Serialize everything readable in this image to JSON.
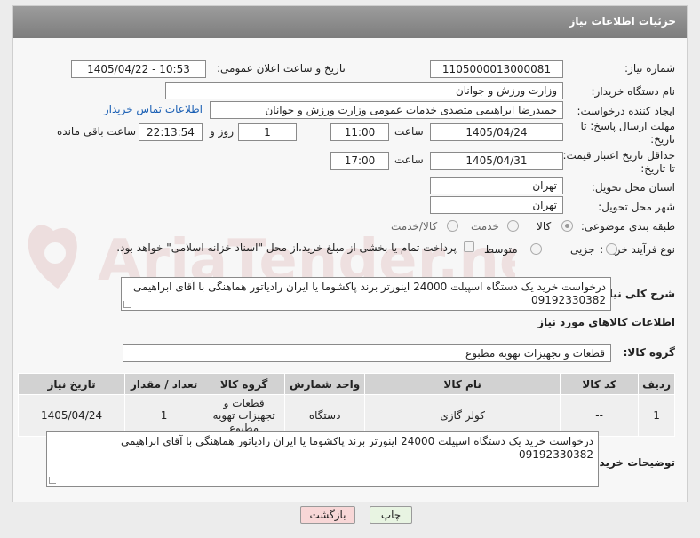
{
  "header": {
    "title": "جزئیات اطلاعات نیاز"
  },
  "fields": {
    "need_number_label": "شماره نیاز:",
    "need_number": "1105000013000081",
    "announce_label": "تاریخ و ساعت اعلان عمومی:",
    "announce_value": "1405/04/22 - 10:53",
    "buyer_org_label": "نام دستگاه خریدار:",
    "buyer_org": "وزارت ورزش و جوانان",
    "creator_label": "ایجاد کننده درخواست:",
    "creator": "حمیدرضا ابراهیمی متصدی خدمات عمومی وزارت ورزش و جوانان",
    "contact_link": "اطلاعات تماس خریدار",
    "deadline_label": "مهلت ارسال پاسخ: تا تاریخ:",
    "deadline_date": "1405/04/24",
    "time_label": "ساعت",
    "deadline_time": "11:00",
    "days_value": "1",
    "days_label": "روز و",
    "remaining_time": "22:13:54",
    "remaining_label": "ساعت باقی مانده",
    "price_valid_label": "حداقل تاریخ اعتبار قیمت: تا تاریخ:",
    "price_valid_date": "1405/04/31",
    "price_valid_time": "17:00",
    "province_label": "استان محل تحویل:",
    "province": "تهران",
    "city_label": "شهر محل تحویل:",
    "city": "تهران",
    "category_label": "طبقه بندی موضوعی:",
    "category_options": [
      "کالا",
      "خدمت",
      "کالا/خدمت"
    ],
    "process_label": "نوع فرآیند خرید :",
    "process_options": [
      "جزیی",
      "متوسط"
    ],
    "payment_note": "پرداخت تمام یا بخشی از مبلغ خرید،از محل \"اسناد خزانه اسلامی\" خواهد بود.",
    "description_label": "شرح کلی نیاز:",
    "description": "درخواست خرید یک دستگاه اسپیلت 24000 اینورتر برند پاکشوما یا ایران رادیاتور هماهنگی با آقای ابراهیمی 09192330382",
    "goods_info_label": "اطلاعات کالاهای مورد نیاز",
    "goods_group_label": "گروه کالا:",
    "goods_group": "قطعات و تجهیزات تهویه مطبوع",
    "buyer_notes_label": "توضیحات خریدار:",
    "buyer_notes": "درخواست خرید یک دستگاه اسپیلت 24000 اینورتر برند پاکشوما یا ایران رادیاتور هماهنگی با آقای ابراهیمی 09192330382"
  },
  "table": {
    "headers": [
      "ردیف",
      "کد کالا",
      "نام کالا",
      "واحد شمارش",
      "گروه کالا",
      "تعداد / مقدار",
      "تاریخ نیاز"
    ],
    "rows": [
      [
        "1",
        "--",
        "کولر گازی",
        "دستگاه",
        "قطعات و تجهیزات تهویه مطبوع",
        "1",
        "1405/04/24"
      ]
    ]
  },
  "buttons": {
    "print": "چاپ",
    "back": "بازگشت"
  },
  "watermark": {
    "text": "AriaTender.net"
  },
  "colors": {
    "header_bg": "#8a8a8a",
    "link": "#1a5fb4",
    "back_btn": "#f8d7d7",
    "print_btn": "#e8f4e2"
  }
}
